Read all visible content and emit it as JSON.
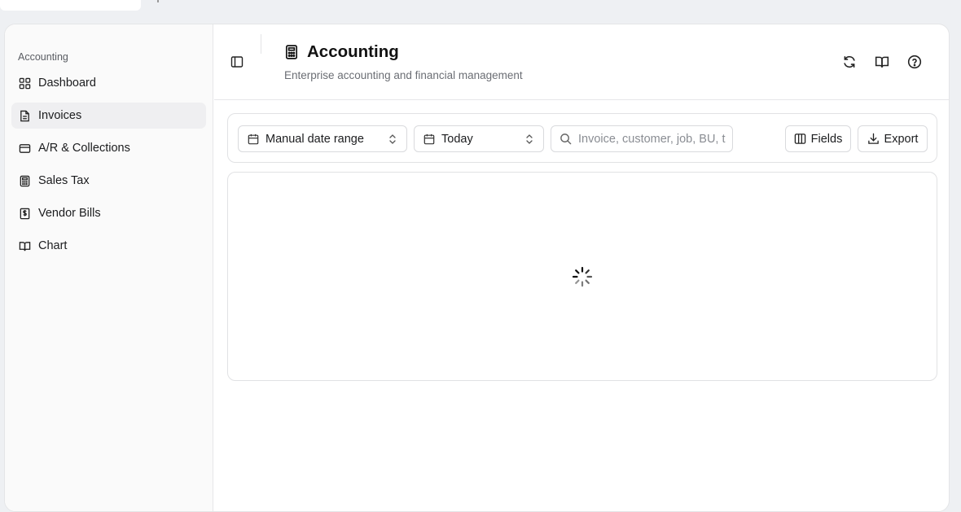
{
  "sidebar": {
    "group_label": "Accounting",
    "items": [
      {
        "label": "Dashboard",
        "icon": "layout-grid-icon",
        "active": false
      },
      {
        "label": "Invoices",
        "icon": "file-text-icon",
        "active": true
      },
      {
        "label": "A/R & Collections",
        "icon": "credit-card-icon",
        "active": false
      },
      {
        "label": "Sales Tax",
        "icon": "calculator-icon",
        "active": false
      },
      {
        "label": "Vendor Bills",
        "icon": "receipt-dollar-icon",
        "active": false
      },
      {
        "label": "Chart",
        "icon": "book-open-icon",
        "active": false
      }
    ]
  },
  "header": {
    "title": "Accounting",
    "subtitle": "Enterprise accounting and financial management",
    "icons": [
      "sidebar-toggle-icon",
      "calculator-icon",
      "refresh-icon",
      "book-open-icon",
      "help-circle-icon"
    ]
  },
  "toolbar": {
    "date_mode": "Manual date range",
    "date_preset": "Today",
    "search_placeholder": "Invoice, customer, job, BU, t",
    "search_value": "",
    "fields_label": "Fields",
    "export_label": "Export"
  },
  "content": {
    "loading": true
  },
  "colors": {
    "accent": "#111111",
    "sidebar_bg": "#fafafa",
    "active_item_bg": "#efeff1",
    "border": "#e1e2e4",
    "muted_text": "#6b6e74"
  }
}
